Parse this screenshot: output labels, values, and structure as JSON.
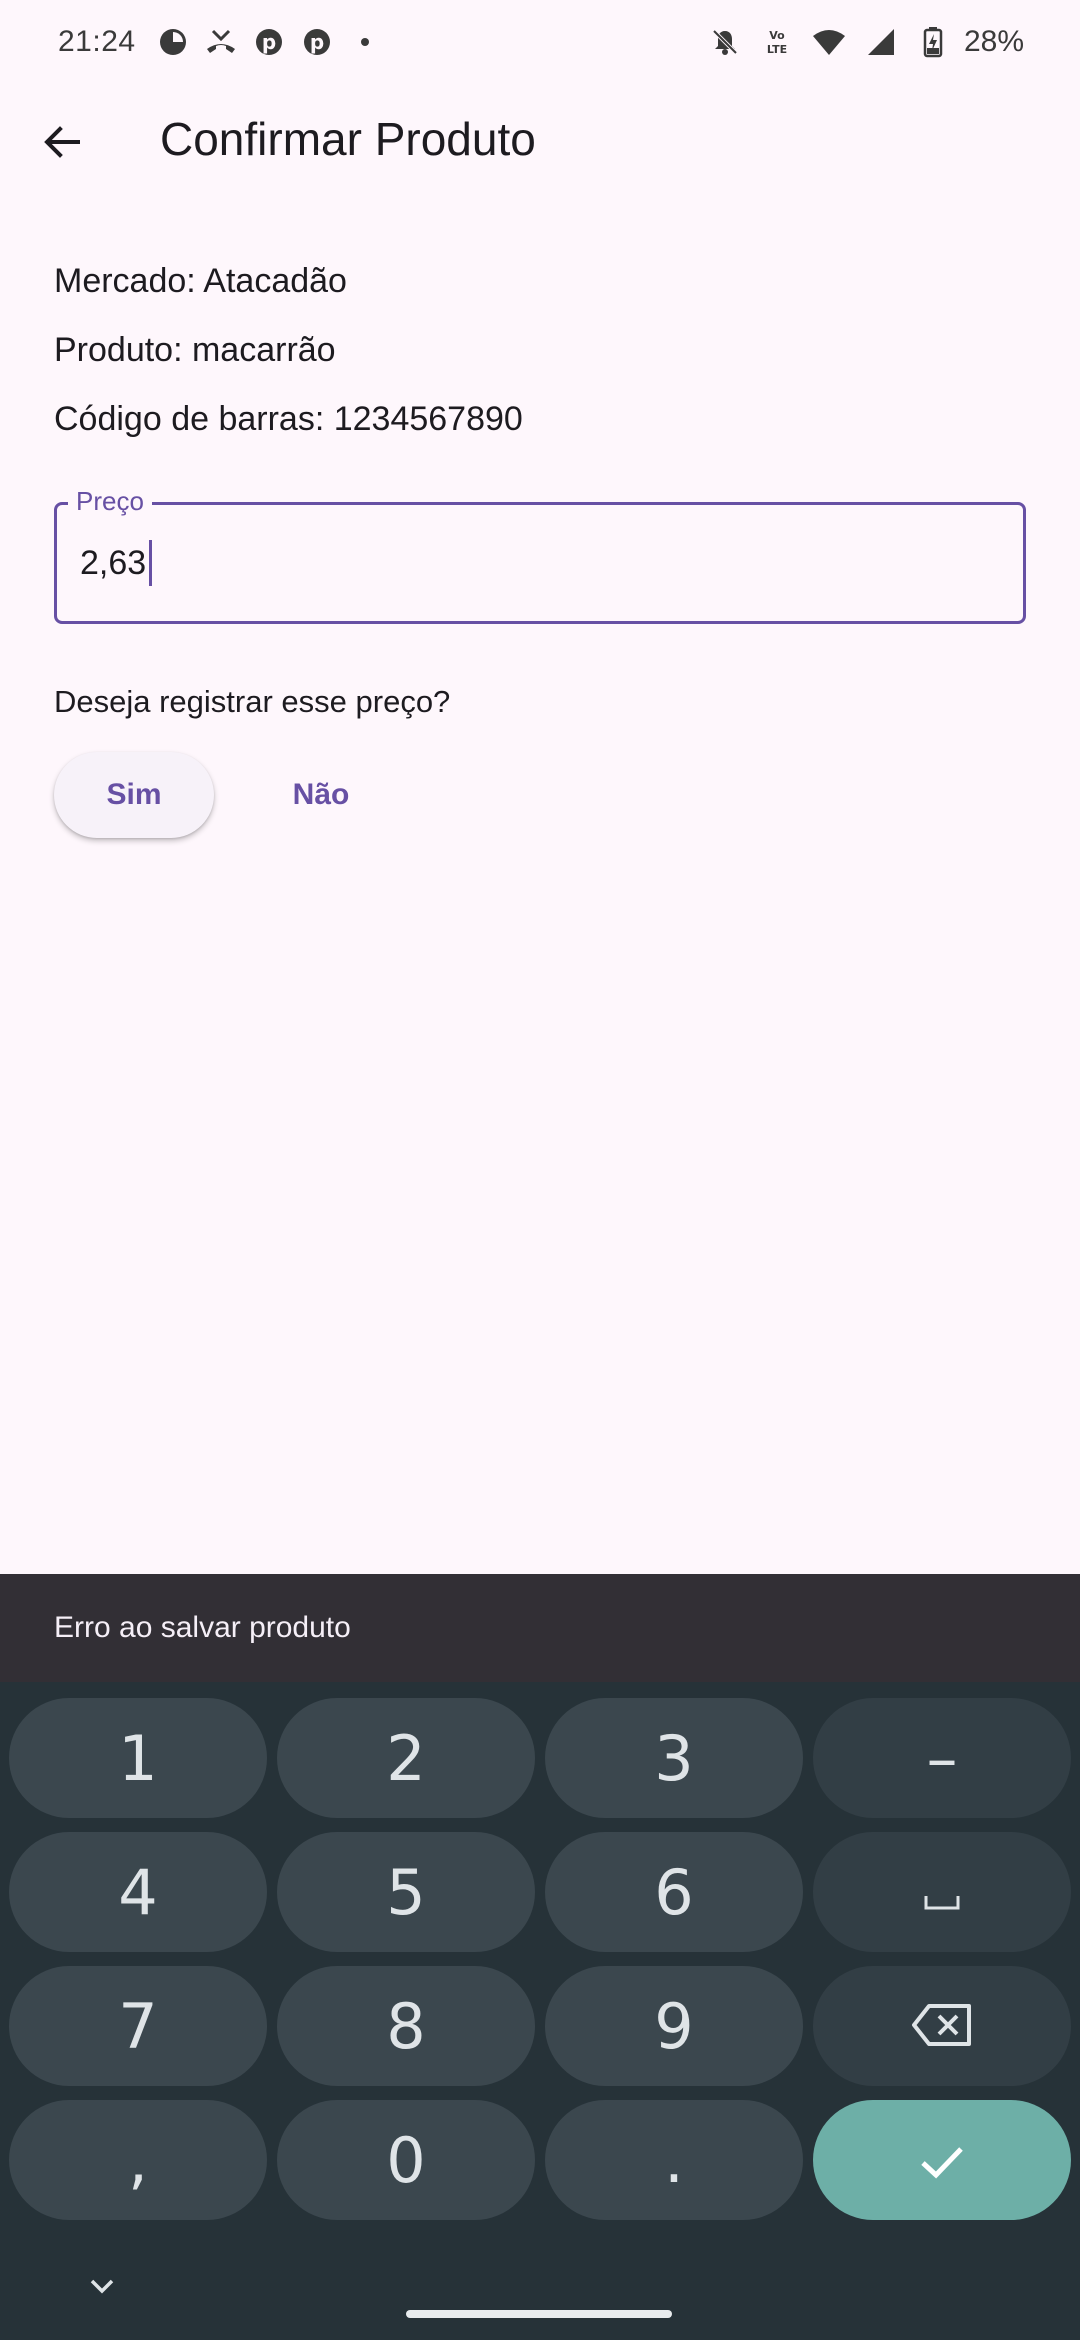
{
  "status_bar": {
    "time": "21:24",
    "battery": "28%",
    "icons_left": [
      "pie-app-icon",
      "missed-call-icon",
      "pinterest-icon",
      "pinterest-icon",
      "dot-icon"
    ],
    "icons_right": [
      "bell-off-icon",
      "volte-icon",
      "wifi-icon",
      "signal-icon",
      "battery-charging-icon"
    ]
  },
  "app_bar": {
    "title": "Confirmar Produto",
    "back_icon": "arrow-back-icon"
  },
  "info": {
    "mercado": "Mercado: Atacadão",
    "produto": "Produto: macarrão",
    "codigo": "Código de barras: 1234567890"
  },
  "price_field": {
    "label": "Preço",
    "value": "2,63"
  },
  "confirm": {
    "question": "Deseja registrar esse preço?",
    "yes_label": "Sim",
    "no_label": "Não"
  },
  "snackbar": {
    "message": "Erro ao salvar produto"
  },
  "keyboard": {
    "keys": {
      "k1": "1",
      "k2": "2",
      "k3": "3",
      "minus": "–",
      "k4": "4",
      "k5": "5",
      "k6": "6",
      "k7": "7",
      "k8": "8",
      "k9": "9",
      "comma": ",",
      "k0": "0",
      "dot": "."
    }
  },
  "colors": {
    "accent": "#6750a4",
    "background": "#fef7fc",
    "snackbar": "#322f35",
    "keyboard_bg": "#263238",
    "key_bg": "#3b474e",
    "enter_key": "#6dafa7"
  }
}
